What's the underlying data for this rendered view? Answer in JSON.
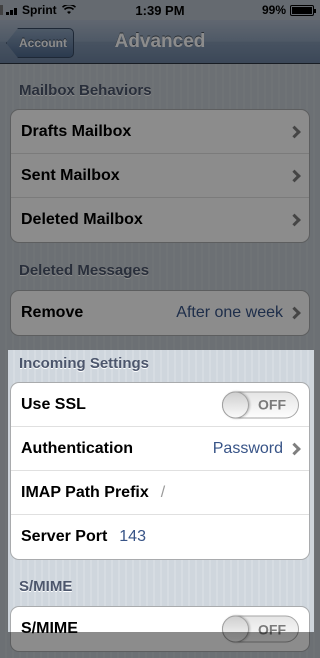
{
  "status_bar": {
    "carrier": "Sprint",
    "time": "1:39 PM",
    "battery": "99%",
    "battery_level": 0.99
  },
  "nav": {
    "back_label": "Account",
    "title": "Advanced"
  },
  "sections": {
    "mailbox_behaviors": {
      "header": "Mailbox Behaviors",
      "rows": [
        "Drafts Mailbox",
        "Sent Mailbox",
        "Deleted Mailbox"
      ]
    },
    "deleted_messages": {
      "header": "Deleted Messages",
      "remove_label": "Remove",
      "remove_value": "After one week"
    },
    "incoming_settings": {
      "header": "Incoming Settings",
      "use_ssl_label": "Use SSL",
      "use_ssl_state": "OFF",
      "authentication_label": "Authentication",
      "authentication_value": "Password",
      "imap_prefix_label": "IMAP Path Prefix",
      "imap_prefix_value": "/",
      "server_port_label": "Server Port",
      "server_port_value": "143"
    },
    "smime": {
      "header": "S/MIME",
      "smime_label": "S/MIME",
      "smime_state": "OFF"
    }
  }
}
